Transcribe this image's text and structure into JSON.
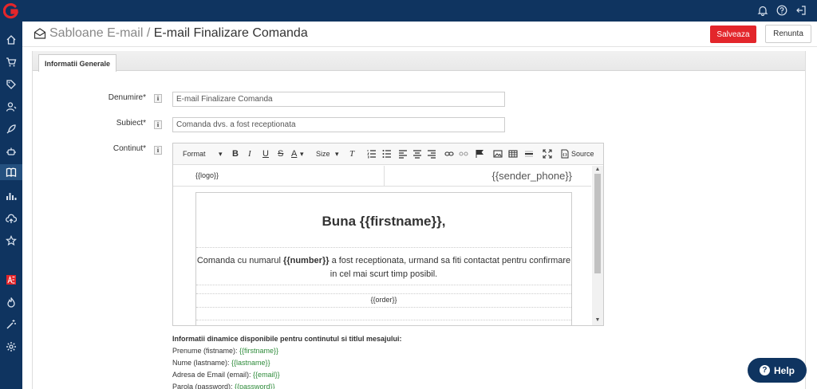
{
  "header": {
    "crumb": "Sabloane E-mail",
    "separator": " / ",
    "title": "E-mail Finalizare Comanda",
    "save_label": "Salveaza",
    "cancel_label": "Renunta"
  },
  "tabs": [
    {
      "label": "Informatii Generale",
      "active": true
    }
  ],
  "form": {
    "name_label": "Denumire*",
    "name_value": "E-mail Finalizare Comanda",
    "subject_label": "Subiect*",
    "subject_value": "Comanda dvs. a fost receptionata",
    "content_label": "Continut*",
    "info_glyph": "i"
  },
  "editor": {
    "format_label": "Format",
    "size_label": "Size",
    "source_label": "Source",
    "logo_placeholder": "{{logo}}",
    "phone_placeholder": "{{sender_phone}}",
    "greeting": "Buna {{firstname}},",
    "message_prefix": "Comanda cu numarul ",
    "message_bold": "{{number}}",
    "message_suffix": " a fost receptionata, urmand sa fiti contactat pentru confirmare in cel mai scurt timp posibil.",
    "order_placeholder": "{{order}}"
  },
  "dynamic_info": {
    "heading": "Informatii dinamice disponibile pentru continutul si titlul mesajului:",
    "items": [
      {
        "label": "Prenume (fistname): ",
        "var": "{{firstname}}"
      },
      {
        "label": "Nume (lastname): ",
        "var": "{{lastname}}"
      },
      {
        "label": "Adresa de Email (email): ",
        "var": "{{email}}"
      },
      {
        "label": "Parola (password): ",
        "var": "{{password}}"
      }
    ]
  },
  "help_label": "Help",
  "colors": {
    "sidebar": "#0f3460",
    "accent_red": "#e3262b",
    "var_green": "#2e8b3a"
  },
  "icons": {
    "sidebar": [
      "home-icon",
      "cart-icon",
      "tag-icon",
      "users-icon",
      "rocket-icon",
      "robot-icon",
      "book-icon",
      "chart-icon",
      "cloud-upload-icon",
      "star-icon",
      "ae-icon",
      "fire-icon",
      "magic-wand-icon",
      "gear-icon"
    ],
    "topbar": [
      "bell-icon",
      "question-icon",
      "logout-icon"
    ]
  }
}
